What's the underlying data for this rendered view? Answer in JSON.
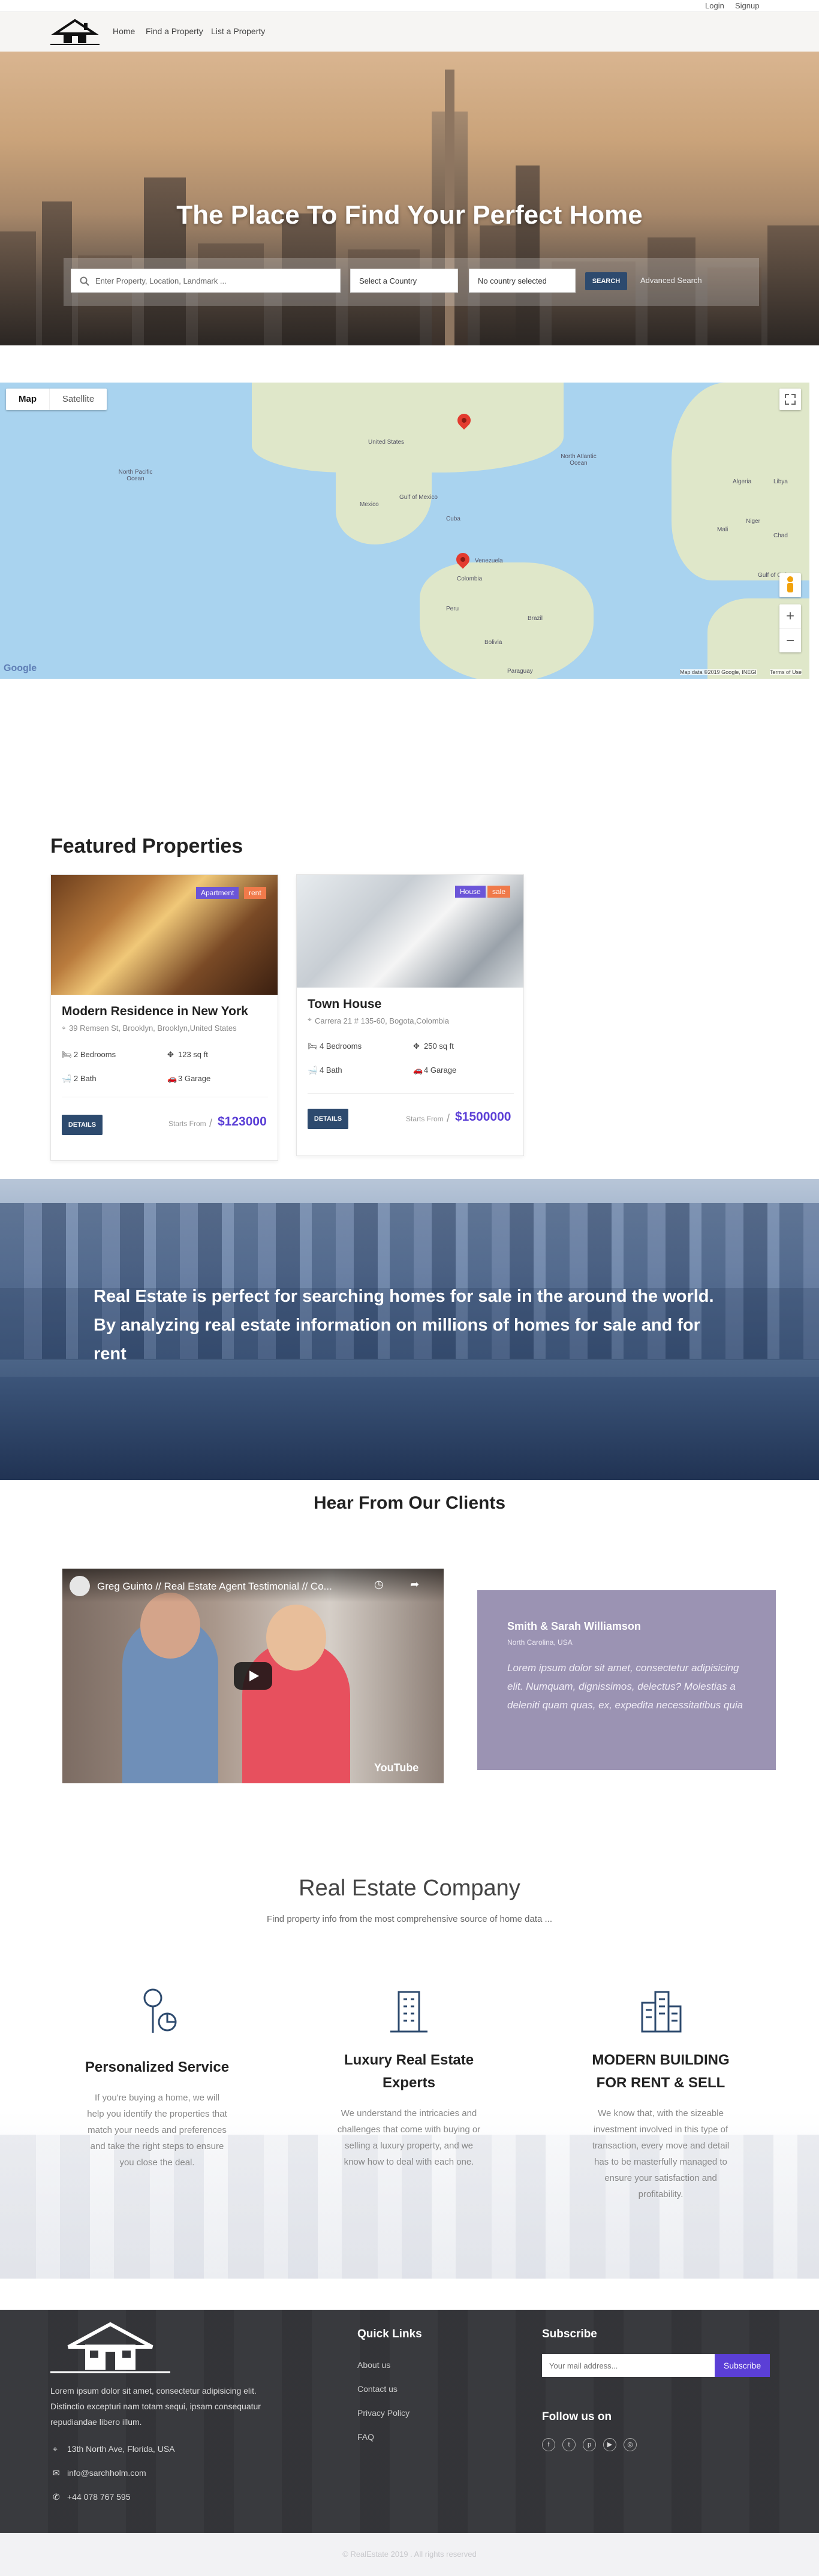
{
  "topbar": {
    "login": "Login",
    "signup": "Signup"
  },
  "nav": {
    "home": "Home",
    "find": "Find a Property",
    "list": "List a Property"
  },
  "hero": {
    "title": "The Place To Find Your Perfect Home",
    "search_placeholder": "Enter Property, Location, Landmark ...",
    "country_select": "Select a Country",
    "city_select": "No country selected",
    "search_button": "SEARCH",
    "advanced": "Advanced Search"
  },
  "map": {
    "tab_map": "Map",
    "tab_satellite": "Satellite",
    "labels": [
      "United States",
      "North Pacific Ocean",
      "North Atlantic Ocean",
      "Mexico",
      "Gulf of Mexico",
      "Cuba",
      "Venezuela",
      "Colombia",
      "Peru",
      "Brazil",
      "Bolivia",
      "Paraguay",
      "Mali",
      "Niger",
      "Chad",
      "Algeria",
      "Libya",
      "Gulf of Guinea"
    ],
    "google": "Google",
    "attribution": "Map data ©2019 Google, INEGI",
    "terms": "Terms of Use",
    "zoom_in": "+",
    "zoom_out": "−"
  },
  "featured": {
    "title": "Featured Properties",
    "cards": [
      {
        "title": "Modern Residence in New York",
        "address": "39 Remsen St, Brooklyn, Brooklyn,United States",
        "bedrooms": "2 Bedrooms",
        "area": "123 sq ft",
        "bath": "2 Bath",
        "garage": "3 Garage",
        "type": "Apartment",
        "status": "rent",
        "details": "DETAILS",
        "starts": "Starts From",
        "price": "$123000"
      },
      {
        "title": "Town House",
        "address": "Carrera 21 # 135-60, Bogota,Colombia",
        "bedrooms": "4 Bedrooms",
        "area": "250 sq ft",
        "bath": "4 Bath",
        "garage": "4 Garage",
        "type": "House",
        "status": "sale",
        "details": "DETAILS",
        "starts": "Starts From",
        "price": "$1500000"
      }
    ]
  },
  "banner": {
    "text": "Real Estate is perfect for searching homes for sale in the around the world. By analyzing real estate information on millions of homes for sale and for rent"
  },
  "testimonials": {
    "title": "Hear From Our Clients",
    "video_title": "Greg Guinto // Real Estate Agent Testimonial // Co...",
    "video_brand": "YouTube",
    "name": "Smith & Sarah Williamson",
    "location": "North Carolina, USA",
    "quote": "Lorem ipsum dolor sit amet, consectetur adipisicing elit. Numquam, dignissimos, delectus? Molestias a deleniti quam quas, ex, expedita necessitatibus quia"
  },
  "company": {
    "title": "Real Estate Company",
    "subtitle": "Find property info from the most comprehensive source of home data ...",
    "services": [
      {
        "title": "Personalized Service",
        "text": "If you're buying a home, we will help you identify the properties that match your needs and preferences and take the right steps to ensure you close the deal."
      },
      {
        "title": "Luxury Real Estate Experts",
        "text": "We understand the intricacies and challenges that come with buying or selling a luxury property, and we know how to deal with each one."
      },
      {
        "title": "MODERN BUILDING FOR RENT & SELL",
        "text": "We know that, with the sizeable investment involved in this type of transaction, every move and detail has to be masterfully managed to ensure your satisfaction and profitability."
      }
    ]
  },
  "footer": {
    "about": "Lorem ipsum dolor sit amet, consectetur adipisicing elit. Distinctio excepturi nam totam sequi, ipsam consequatur repudiandae libero illum.",
    "address": "13th North Ave, Florida, USA",
    "email": "info@sarchholm.com",
    "phone": "+44 078 767 595",
    "quick_links_title": "Quick Links",
    "links": [
      "About us",
      "Contact us",
      "Privacy Policy",
      "FAQ"
    ],
    "subscribe_title": "Subscribe",
    "email_placeholder": "Your mail address...",
    "subscribe_button": "Subscribe",
    "follow_title": "Follow us on",
    "social": [
      "facebook-icon",
      "twitter-icon",
      "pinterest-icon",
      "youtube-icon",
      "dribbble-icon"
    ],
    "copyright": "© RealEstate 2019 . All rights reserved"
  }
}
